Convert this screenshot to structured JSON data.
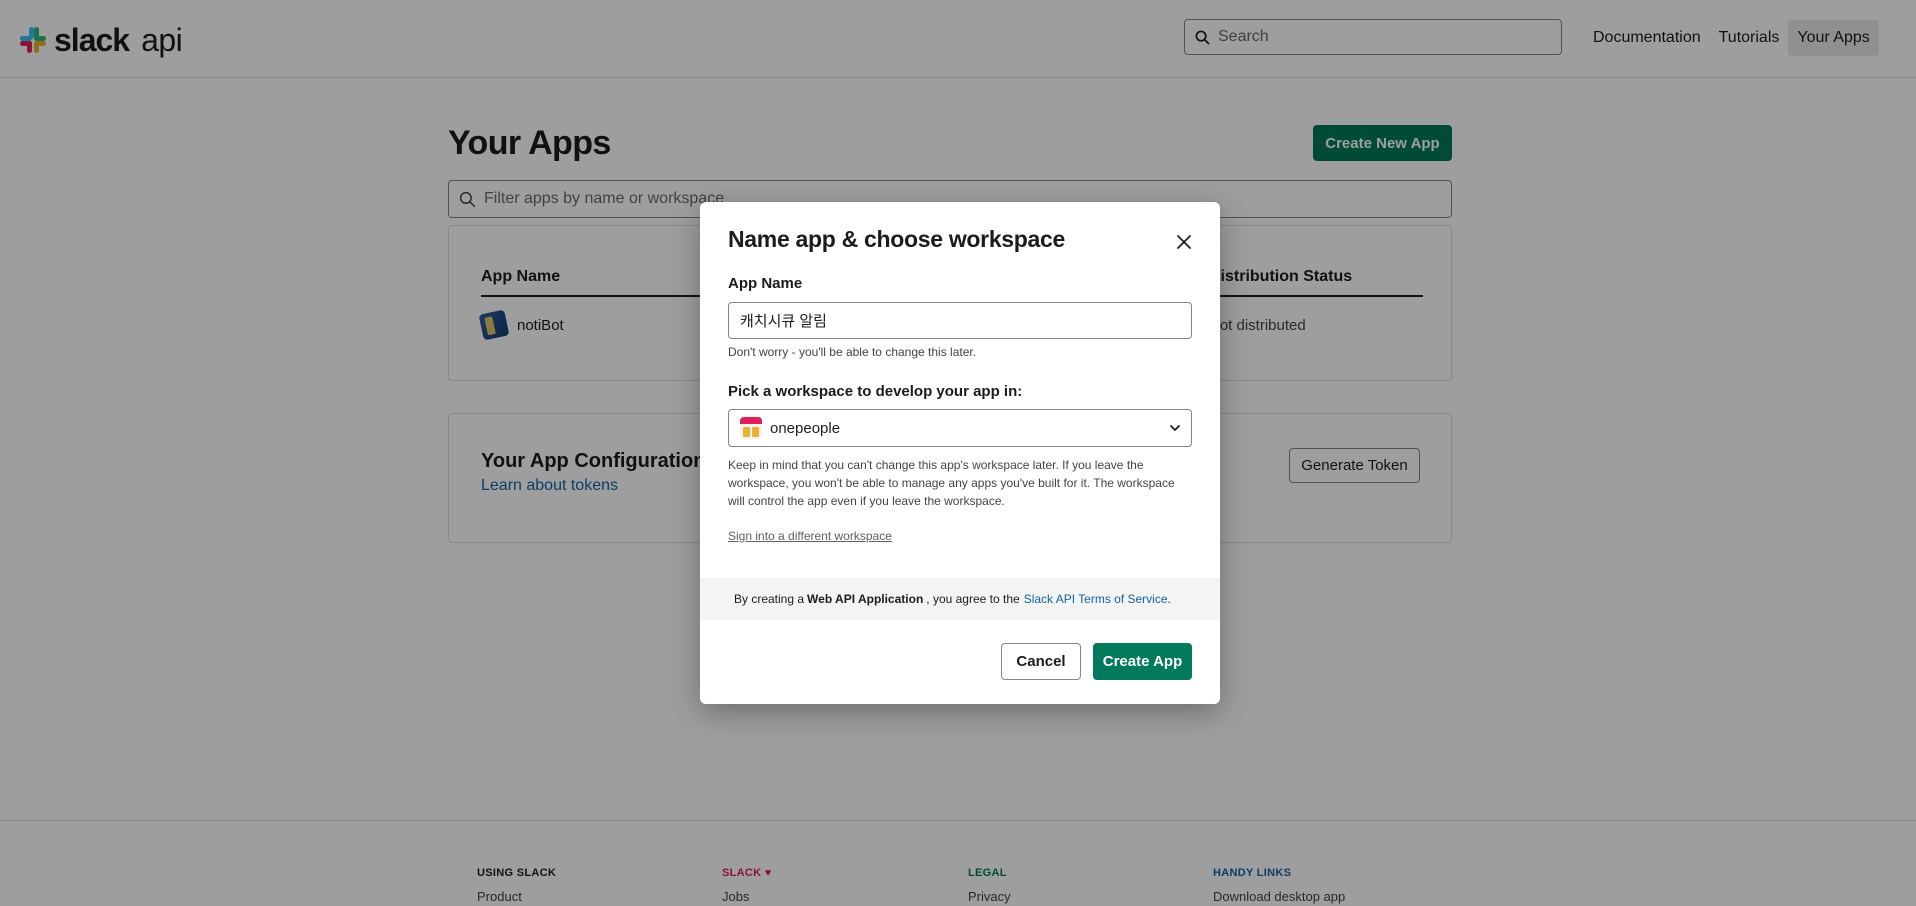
{
  "header": {
    "logo_strong": "slack",
    "logo_suffix": "api",
    "search_placeholder": "Search",
    "nav": [
      "Documentation",
      "Tutorials",
      "Your Apps"
    ]
  },
  "main": {
    "title": "Your Apps",
    "create_button": "Create New App",
    "filter_placeholder": "Filter apps by name or workspace",
    "apps_table": {
      "col_app_name": "App Name",
      "col_distribution": "Distribution Status",
      "rows": [
        {
          "name": "notiBot",
          "distribution": "Not distributed"
        }
      ]
    },
    "tokens": {
      "title": "Your App Configuration Tokens",
      "link": "Learn about tokens",
      "generate_button": "Generate Token"
    }
  },
  "footer": {
    "columns": [
      {
        "heading": "USING SLACK",
        "item": "Product",
        "color": "#1d1c1d"
      },
      {
        "heading": "SLACK ♥",
        "item": "Jobs",
        "color": "#e01e5a"
      },
      {
        "heading": "LEGAL",
        "item": "Privacy",
        "color": "#007a5a"
      },
      {
        "heading": "HANDY LINKS",
        "item": "Download desktop app",
        "color": "#1264a3"
      }
    ]
  },
  "modal": {
    "title": "Name app & choose workspace",
    "app_name_label": "App Name",
    "app_name_value": "캐치시큐 알림",
    "app_name_helper": "Don't worry - you'll be able to change this later.",
    "workspace_label": "Pick a workspace to develop your app in:",
    "workspace_value": "onepeople",
    "workspace_helper": "Keep in mind that you can't change this app's workspace later. If you leave the workspace, you won't be able to manage any apps you've built for it. The workspace will control the app even if you leave the workspace.",
    "sign_in_link": "Sign into a different workspace",
    "terms_prefix": "By creating a",
    "terms_bold": "Web API Application",
    "terms_middle": ", you agree to the",
    "terms_link": "Slack API Terms of Service",
    "terms_suffix": ".",
    "cancel_button": "Cancel",
    "create_button": "Create App"
  },
  "colors": {
    "brand_green": "#007a5a",
    "link_blue": "#1264a3"
  }
}
